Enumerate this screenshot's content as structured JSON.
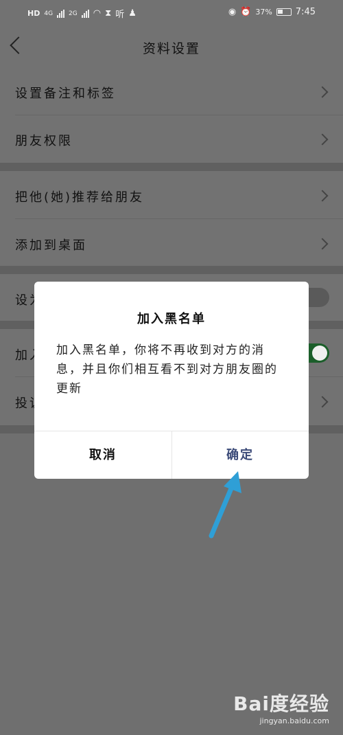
{
  "status_bar": {
    "left_text": "HD",
    "net1": "4G",
    "net2": "2G",
    "app_text": "听",
    "battery_percent": "37%",
    "time": "7:45"
  },
  "nav": {
    "title": "资料设置"
  },
  "settings": {
    "remark_tags": "设置备注和标签",
    "friend_permissions": "朋友权限",
    "recommend": "把他(她)推荐给朋友",
    "add_desktop": "添加到桌面",
    "star_partial": "设为",
    "blacklist_partial": "加入",
    "report_partial": "投诉"
  },
  "dialog": {
    "title": "加入黑名单",
    "message": "加入黑名单，你将不再收到对方的消息，并且你们相互看不到对方朋友圈的更新",
    "cancel": "取消",
    "confirm": "确定"
  },
  "watermark": {
    "logo": "Bai度经验",
    "url": "jingyan.baidu.com"
  },
  "colors": {
    "arrow": "#2f9fd6",
    "confirm_text": "#3b4a78",
    "toggle_on": "#1b5e2a"
  }
}
